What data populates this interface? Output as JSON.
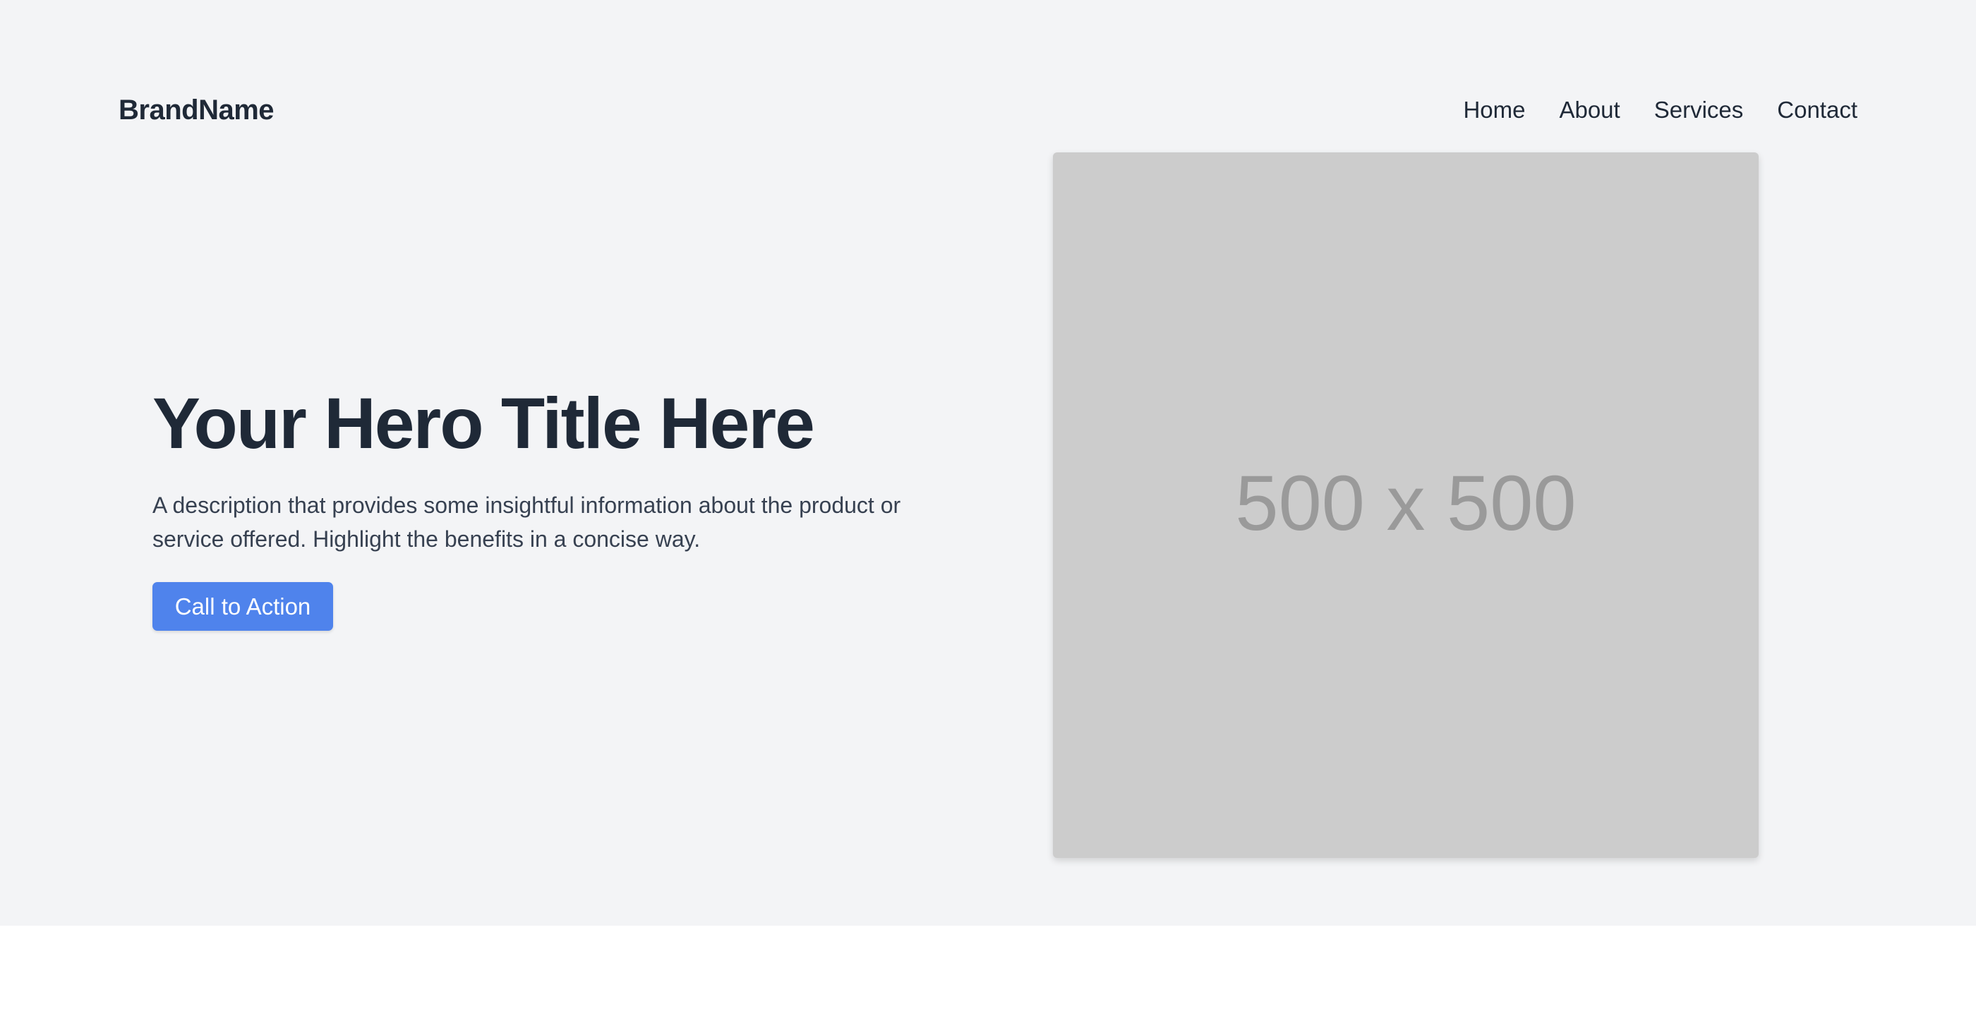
{
  "header": {
    "brand": "BrandName",
    "nav": [
      {
        "label": "Home"
      },
      {
        "label": "About"
      },
      {
        "label": "Services"
      },
      {
        "label": "Contact"
      }
    ]
  },
  "hero": {
    "title": "Your Hero Title Here",
    "description": "A description that provides some insightful information about the product or service offered. Highlight the benefits in a concise way.",
    "cta_label": "Call to Action",
    "image_placeholder": "500 x 500"
  },
  "colors": {
    "hero_background": "#f3f4f6",
    "text_primary": "#1f2937",
    "accent": "#4f83ec",
    "placeholder_fill": "#cccccc",
    "placeholder_text": "#9a9a9a"
  }
}
